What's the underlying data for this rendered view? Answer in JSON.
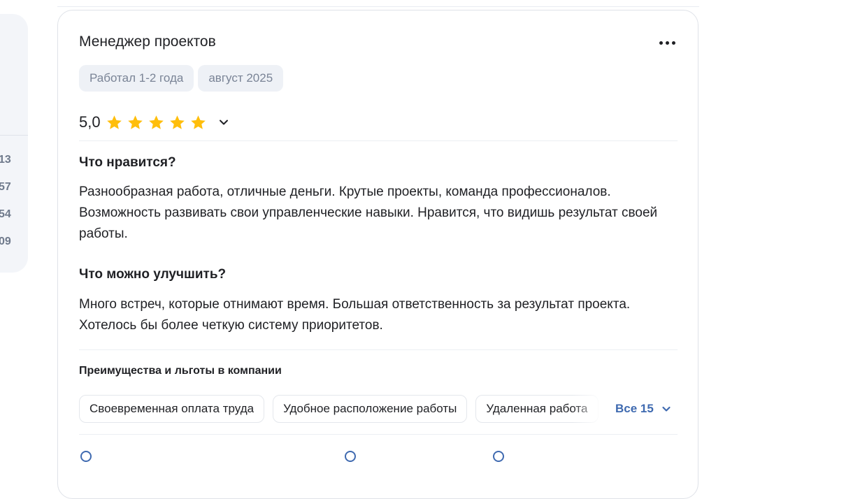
{
  "sidebar": {
    "numbers": [
      "13",
      "57",
      "54",
      "09"
    ]
  },
  "review": {
    "title": "Менеджер проектов",
    "tags": [
      "Работал 1-2 года",
      "август 2025"
    ],
    "rating": {
      "value_label": "5,0",
      "stars": 5,
      "max_stars": 5
    },
    "likes_heading": "Что нравится?",
    "likes_text": "Разнообразная работа, отличные деньги. Крутые проекты, команда профессионалов. Возможность развивать свои управленческие навыки. Нравится, что видишь результат своей работы.",
    "improve_heading": "Что можно улучшить?",
    "improve_text": "Много встреч, которые отнимают время. Большая ответственность за результат проекта. Хотелось бы более четкую систему приоритетов.",
    "benefits": {
      "heading": "Преимущества и льготы в компании",
      "chips": [
        "Своевременная оплата труда",
        "Удобное расположение работы",
        "Удаленная работа"
      ],
      "all_label": "Все 15"
    }
  },
  "colors": {
    "star": "#ffbe0b",
    "link": "#3f6ab0",
    "tag_bg": "#eef1f6",
    "tag_text": "#7a8496"
  },
  "icons": {
    "more": "more-horizontal-icon",
    "rating_toggle": "chevron-down-icon",
    "benefits_toggle": "chevron-down-icon",
    "star": "star-icon"
  }
}
